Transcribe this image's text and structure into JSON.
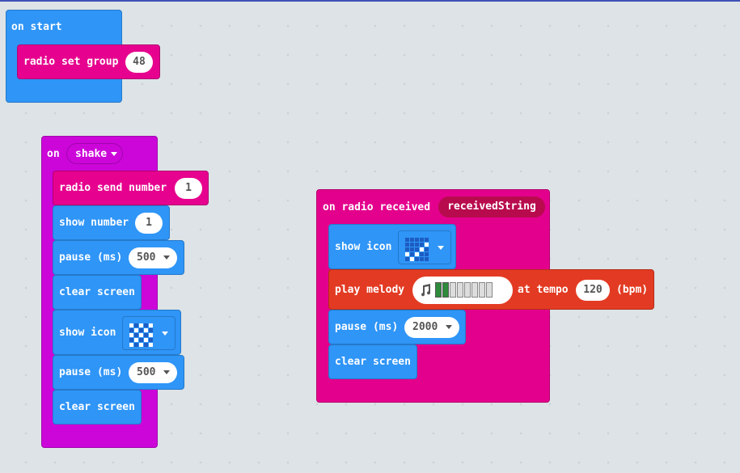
{
  "on_start": {
    "hat_label": "on start",
    "radio_set_group": {
      "label": "radio set group",
      "value": "48"
    }
  },
  "on_shake": {
    "hat_label": "on",
    "gesture": "shake",
    "blocks": {
      "radio_send_number": {
        "label": "radio send number",
        "value": "1"
      },
      "show_number": {
        "label": "show number",
        "value": "1"
      },
      "pause_1": {
        "label": "pause (ms)",
        "value": "500"
      },
      "clear_screen_1": {
        "label": "clear screen"
      },
      "show_icon": {
        "label": "show icon",
        "icon": "checker-icon"
      },
      "pause_2": {
        "label": "pause (ms)",
        "value": "500"
      },
      "clear_screen_2": {
        "label": "clear screen"
      }
    }
  },
  "on_radio_received": {
    "hat_label": "on radio received",
    "variable": "receivedString",
    "blocks": {
      "show_icon": {
        "label": "show icon",
        "icon": "pattern-icon"
      },
      "play_melody": {
        "label": "play melody",
        "at_tempo_label": "at tempo",
        "tempo": "120",
        "unit": "(bpm)",
        "melody_icon": "music-note-icon"
      },
      "pause": {
        "label": "pause (ms)",
        "value": "2000"
      },
      "clear_screen": {
        "label": "clear screen"
      }
    }
  },
  "colors": {
    "basic": "#2f95f7",
    "radio": "#e6028e",
    "input": "#cc06d9",
    "music": "#e33b23",
    "workspace": "#ecf0f1"
  }
}
